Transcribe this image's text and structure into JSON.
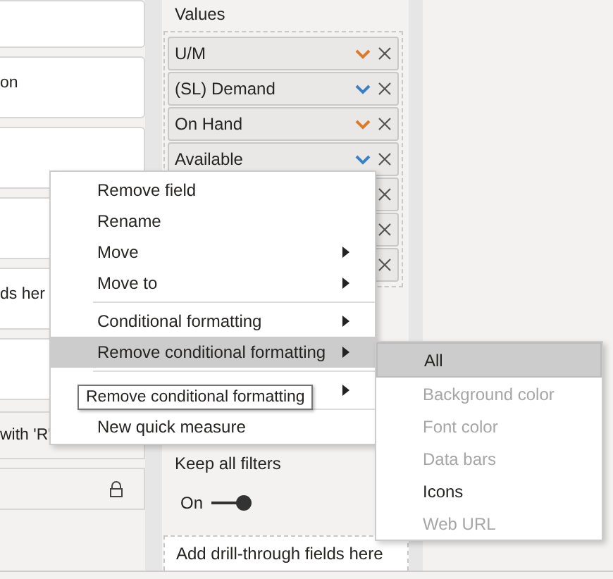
{
  "left_cards": [
    {
      "kind": "blank"
    },
    {
      "kind": "text",
      "text": "on"
    },
    {
      "kind": "blank"
    },
    {
      "kind": "blank"
    },
    {
      "kind": "text",
      "text": "ds her"
    },
    {
      "kind": "blank"
    }
  ],
  "filter_card": {
    "text": "with 'R'"
  },
  "lock_card": {
    "locked": true
  },
  "values_section": {
    "title": "Values",
    "fields": [
      {
        "kind": "field",
        "label": "U/M",
        "color": "#d97b2b"
      },
      {
        "kind": "field",
        "label": "(SL) Demand",
        "color": "#3b7fc4"
      },
      {
        "kind": "field",
        "label": "On Hand",
        "color": "#d97b2b"
      },
      {
        "kind": "field",
        "label": "Available",
        "color": "#3b7fc4"
      },
      {
        "kind": "covered"
      },
      {
        "kind": "covered"
      },
      {
        "kind": "covered"
      }
    ]
  },
  "keep_all_filters": {
    "label": "Keep all filters",
    "toggle_label": "On",
    "on": true
  },
  "drill_through": {
    "placeholder": "Add drill-through fields here"
  },
  "context_menu": {
    "items": [
      {
        "kind": "item",
        "label": "Remove field",
        "submenu": false,
        "selected": false
      },
      {
        "kind": "item",
        "label": "Rename",
        "submenu": false,
        "selected": false
      },
      {
        "kind": "item",
        "label": "Move",
        "submenu": true,
        "selected": false
      },
      {
        "kind": "item",
        "label": "Move to",
        "submenu": true,
        "selected": false
      },
      {
        "kind": "divider"
      },
      {
        "kind": "item",
        "label": "Conditional formatting",
        "submenu": true,
        "selected": false
      },
      {
        "kind": "item",
        "label": "Remove conditional formatting",
        "submenu": true,
        "selected": true
      },
      {
        "kind": "divider"
      },
      {
        "kind": "item",
        "submenu": true,
        "selected": false
      },
      {
        "kind": "divider"
      },
      {
        "kind": "item",
        "label": "New quick measure",
        "submenu": false,
        "selected": false
      }
    ]
  },
  "tooltip": {
    "text": "Remove conditional formatting"
  },
  "submenu": {
    "items": [
      {
        "label": "All",
        "selected": true,
        "disabled": false
      },
      {
        "label": "Background color",
        "selected": false,
        "disabled": true
      },
      {
        "label": "Font color",
        "selected": false,
        "disabled": true
      },
      {
        "label": "Data bars",
        "selected": false,
        "disabled": true
      },
      {
        "label": "Icons",
        "selected": false,
        "disabled": false
      },
      {
        "label": "Web URL",
        "selected": false,
        "disabled": true
      }
    ]
  }
}
